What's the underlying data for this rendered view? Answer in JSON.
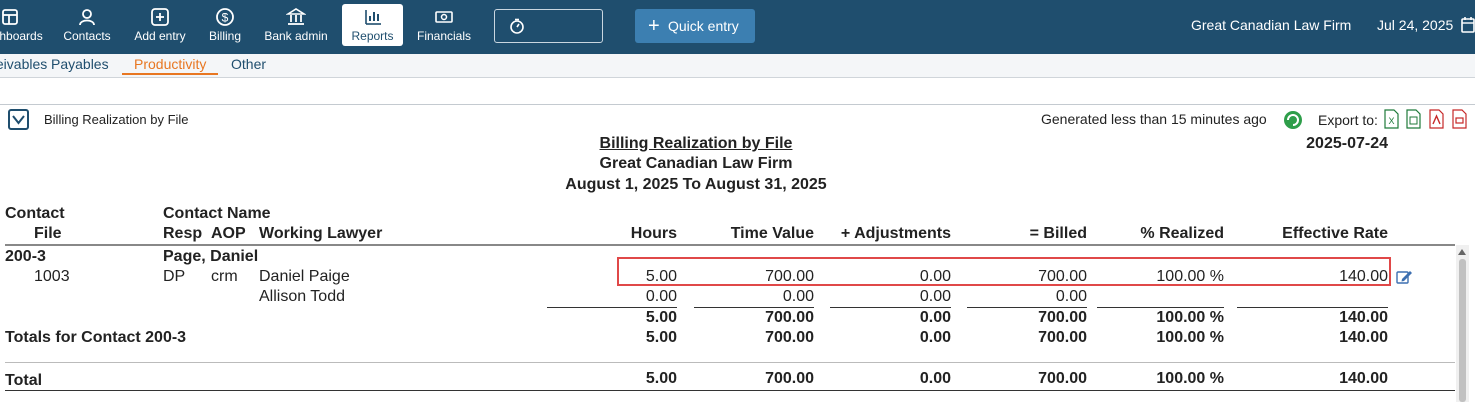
{
  "topnav": {
    "items": [
      {
        "label": "Dashboards",
        "icon": "dashboard-icon"
      },
      {
        "label": "Contacts",
        "icon": "contacts-icon"
      },
      {
        "label": "Add entry",
        "icon": "add-entry-icon"
      },
      {
        "label": "Billing",
        "icon": "billing-icon"
      },
      {
        "label": "Bank admin",
        "icon": "bank-icon"
      },
      {
        "label": "Reports",
        "icon": "reports-icon",
        "active": true
      },
      {
        "label": "Financials",
        "icon": "financials-icon"
      }
    ],
    "quick_entry": "Quick entry",
    "firm": "Great Canadian Law Firm",
    "date": "Jul 24, 2025"
  },
  "subnav": {
    "tabs": [
      "Receivables",
      "Payables",
      "Productivity",
      "Other"
    ],
    "active": "Productivity"
  },
  "report_header": {
    "name": "Billing Realization by File",
    "generated": "Generated less than 15 minutes ago",
    "export_label": "Export to:"
  },
  "report": {
    "title": "Billing Realization by File",
    "firm": "Great Canadian Law Firm",
    "period": "August 1, 2025 To August 31, 2025",
    "date": "2025-07-24",
    "headers": {
      "contact": "Contact",
      "file": "File",
      "contact_name": "Contact Name",
      "resp": "Resp",
      "aop": "AOP",
      "working_lawyer": "Working Lawyer",
      "hours": "Hours",
      "time_value": "Time Value",
      "adjustments": "+ Adjustments",
      "billed": "= Billed",
      "realized": "% Realized",
      "effective_rate": "Effective Rate"
    },
    "contact": {
      "id": "200-3",
      "name": "Page, Daniel"
    },
    "rows": [
      {
        "file": "1003",
        "resp": "DP",
        "aop": "crm",
        "lawyer": "Daniel Paige",
        "hours": "5.00",
        "time_value": "700.00",
        "adjustments": "0.00",
        "billed": "700.00",
        "realized": "100.00 %",
        "rate": "140.00"
      },
      {
        "file": "",
        "resp": "",
        "aop": "",
        "lawyer": "Allison Todd",
        "hours": "0.00",
        "time_value": "0.00",
        "adjustments": "0.00",
        "billed": "0.00",
        "realized": "",
        "rate": ""
      }
    ],
    "file_subtotal": {
      "hours": "5.00",
      "time_value": "700.00",
      "adjustments": "0.00",
      "billed": "700.00",
      "realized": "100.00 %",
      "rate": "140.00"
    },
    "contact_total": {
      "label": "Totals for Contact 200-3",
      "hours": "5.00",
      "time_value": "700.00",
      "adjustments": "0.00",
      "billed": "700.00",
      "realized": "100.00 %",
      "rate": "140.00"
    },
    "grand_total": {
      "label": "Total",
      "hours": "5.00",
      "time_value": "700.00",
      "adjustments": "0.00",
      "billed": "700.00",
      "realized": "100.00 %",
      "rate": "140.00"
    }
  },
  "colors": {
    "nav_bg": "#1f4e6e",
    "accent": "#e87722",
    "quick_entry": "#3c7fb1",
    "highlight": "#e04848"
  }
}
